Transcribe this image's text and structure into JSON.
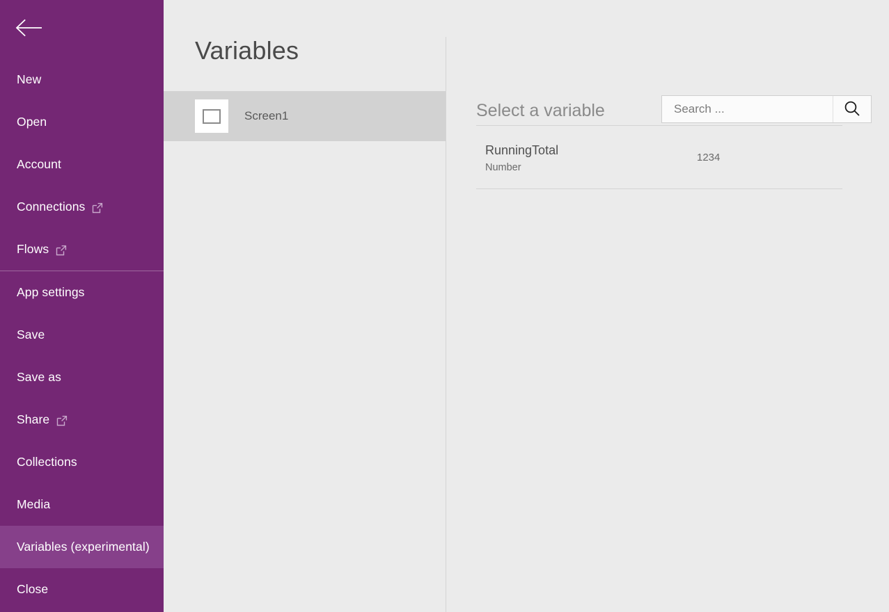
{
  "sidebar": {
    "back_icon": "back-arrow-icon",
    "accent_color": "#742774",
    "selected_color": "#86408a",
    "items": [
      {
        "label": "New",
        "icon": null,
        "selected": false,
        "separator_above": false
      },
      {
        "label": "Open",
        "icon": null,
        "selected": false,
        "separator_above": false
      },
      {
        "label": "Account",
        "icon": null,
        "selected": false,
        "separator_above": false
      },
      {
        "label": "Connections",
        "icon": "open-external-icon",
        "selected": false,
        "separator_above": false
      },
      {
        "label": "Flows",
        "icon": "open-external-icon",
        "selected": false,
        "separator_above": false
      },
      {
        "label": "App settings",
        "icon": null,
        "selected": false,
        "separator_above": true
      },
      {
        "label": "Save",
        "icon": null,
        "selected": false,
        "separator_above": false
      },
      {
        "label": "Save as",
        "icon": null,
        "selected": false,
        "separator_above": false
      },
      {
        "label": "Share",
        "icon": "open-external-icon",
        "selected": false,
        "separator_above": false
      },
      {
        "label": "Collections",
        "icon": null,
        "selected": false,
        "separator_above": false
      },
      {
        "label": "Media",
        "icon": null,
        "selected": false,
        "separator_above": false
      },
      {
        "label": "Variables (experimental)",
        "icon": null,
        "selected": true,
        "separator_above": false
      },
      {
        "label": "Close",
        "icon": null,
        "selected": false,
        "separator_above": false
      }
    ]
  },
  "mid_panel": {
    "title": "Variables",
    "screen": {
      "label": "Screen1",
      "thumbnail_icon": "screen-thumbnail-icon",
      "selected": true
    }
  },
  "right_panel": {
    "title": "Select a variable",
    "search": {
      "placeholder": "Search ...",
      "value": "",
      "icon": "search-icon"
    },
    "variables": [
      {
        "name": "RunningTotal",
        "type": "Number",
        "value": "1234"
      }
    ]
  }
}
